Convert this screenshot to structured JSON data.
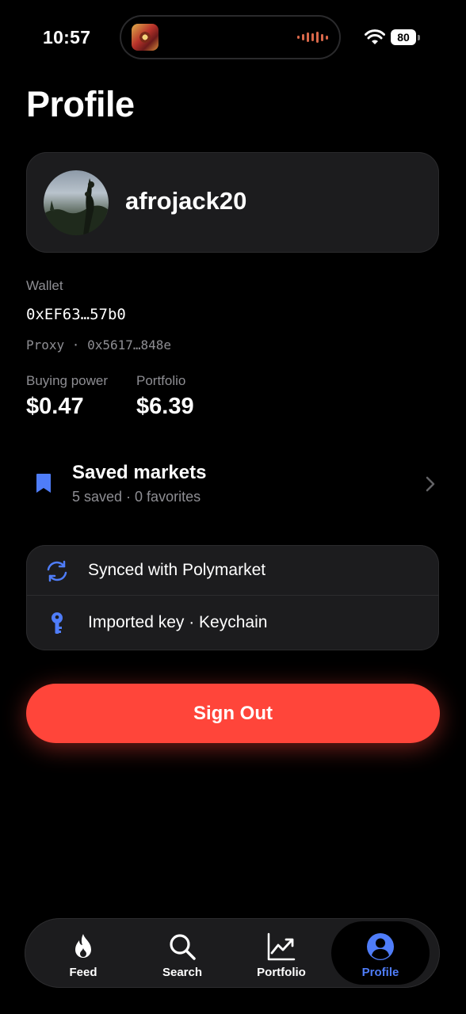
{
  "status": {
    "time": "10:57",
    "battery": "80",
    "icons": [
      "album-art-icon",
      "waveform-icon",
      "wifi-icon",
      "battery-icon"
    ]
  },
  "page": {
    "title": "Profile"
  },
  "profile": {
    "username": "afrojack20"
  },
  "wallet": {
    "label": "Wallet",
    "address": "0xEF63…57b0",
    "proxy": "Proxy · 0x5617…848e"
  },
  "stats": {
    "buying_power_label": "Buying power",
    "buying_power_value": "$0.47",
    "portfolio_label": "Portfolio",
    "portfolio_value": "$6.39"
  },
  "saved": {
    "title": "Saved markets",
    "subtitle": "5 saved · 0 favorites"
  },
  "info": {
    "sync": "Synced with Polymarket",
    "key": "Imported key · Keychain"
  },
  "actions": {
    "sign_out": "Sign Out"
  },
  "tabs": [
    {
      "label": "Feed",
      "icon": "flame-icon"
    },
    {
      "label": "Search",
      "icon": "search-icon"
    },
    {
      "label": "Portfolio",
      "icon": "chart-icon"
    },
    {
      "label": "Profile",
      "icon": "person-icon",
      "active": true
    }
  ],
  "colors": {
    "background": "#000000",
    "card": "#1c1c1e",
    "accent": "#4f7df9",
    "destructive": "#ff453a",
    "secondary_text": "#8e8e93"
  }
}
